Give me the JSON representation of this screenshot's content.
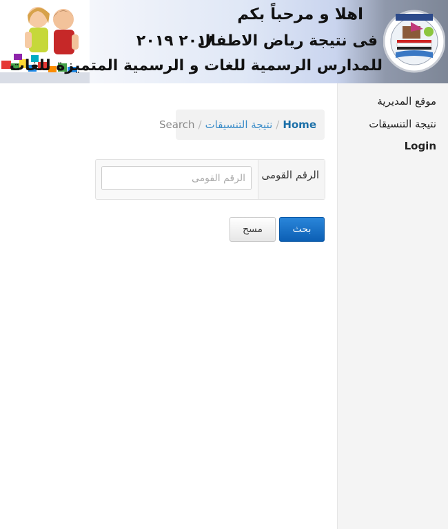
{
  "banner": {
    "line1": "اهلا و مرحباً بكم",
    "line2": "فى نتيجة رياض الاطفال",
    "line2_year": "٢٠١٨ ٢٠١٩",
    "line3": "للمدارس الرسمية للغات و الرسمية المتميزة للغات"
  },
  "sidebar": {
    "items": [
      {
        "label": "موقع المديرية"
      },
      {
        "label": "نتيجة التنسيقات"
      },
      {
        "label": "Login"
      }
    ]
  },
  "breadcrumb": {
    "home": "Home",
    "middle": "نتيجة التنسيقات",
    "current": "Search",
    "separator": "/"
  },
  "form": {
    "national_id_label": "الرقم القومى",
    "national_id_placeholder": "الرقم القومى",
    "national_id_value": ""
  },
  "buttons": {
    "search_label": "بحث",
    "clear_label": "مسح"
  },
  "colors": {
    "link": "#1a6fa8",
    "primary_button": "#0c5fb4",
    "sidebar_bg": "#f4f4f4"
  }
}
